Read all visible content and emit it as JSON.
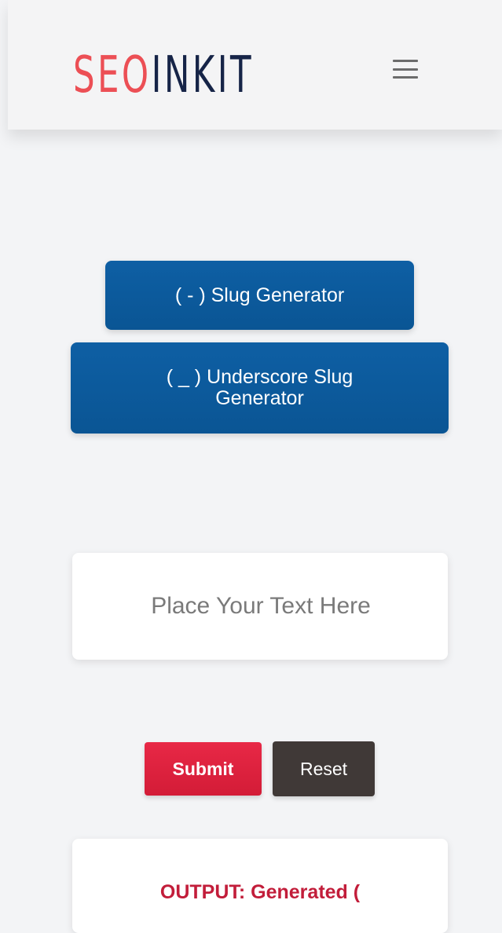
{
  "header": {
    "logo": {
      "part_a": "SEO",
      "part_b": "INKIT",
      "color_a": "#ec4f55",
      "color_b": "#162447"
    },
    "menu_icon": "hamburger-menu-icon"
  },
  "tools": {
    "slug_generator_label": "( - ) Slug Generator",
    "underscore_slug_generator_label": "( _ ) Underscore Slug Generator",
    "button_color": "#0e5fa4"
  },
  "input": {
    "value": "",
    "placeholder": "Place Your Text Here"
  },
  "actions": {
    "submit_label": "Submit",
    "reset_label": "Reset",
    "submit_color": "#e82846",
    "reset_color": "#403937"
  },
  "output": {
    "label": "OUTPUT: Generated (",
    "label_color": "#c21d3a"
  }
}
